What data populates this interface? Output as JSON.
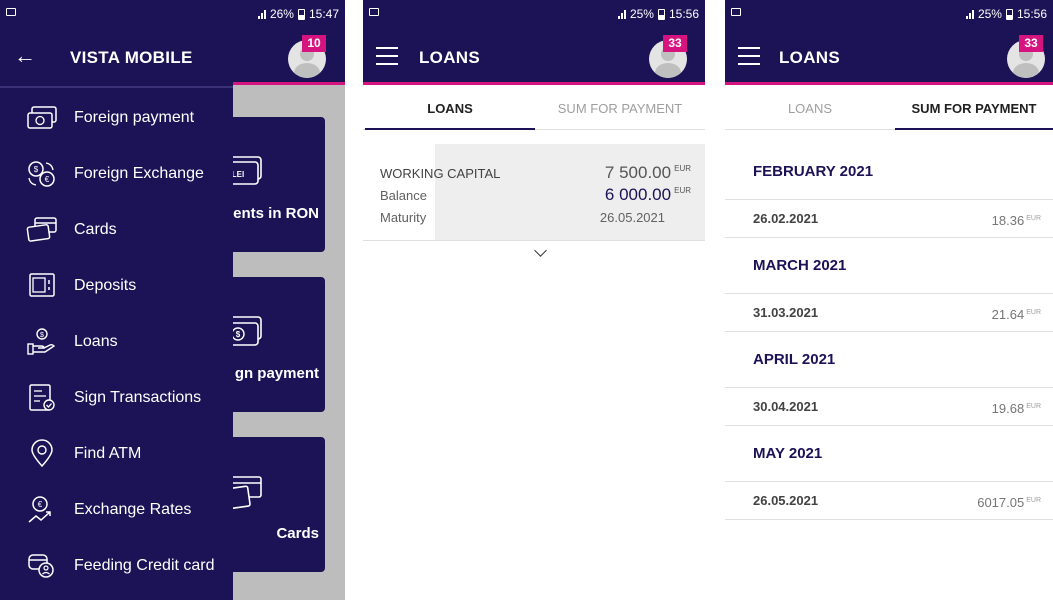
{
  "screen1": {
    "status": {
      "battery": "26%",
      "time": "15:47"
    },
    "drawer": {
      "title": "VISTA MOBILE",
      "items": [
        {
          "label": "Foreign payment",
          "icon": "foreign-payment-icon"
        },
        {
          "label": "Foreign Exchange",
          "icon": "exchange-icon"
        },
        {
          "label": "Cards",
          "icon": "cards-icon"
        },
        {
          "label": "Deposits",
          "icon": "deposits-icon"
        },
        {
          "label": "Loans",
          "icon": "loans-icon"
        },
        {
          "label": "Sign Transactions",
          "icon": "sign-icon"
        },
        {
          "label": "Find ATM",
          "icon": "location-pin-icon"
        },
        {
          "label": "Exchange Rates",
          "icon": "exchange-rates-icon"
        },
        {
          "label": "Feeding Credit card",
          "icon": "feeding-card-icon"
        }
      ]
    },
    "badge": "10",
    "tiles": [
      {
        "label": "ents in RON",
        "icon_text": "LEI"
      },
      {
        "label": "gn payment",
        "icon_text": "$"
      },
      {
        "label": "Cards",
        "icon_text": ""
      }
    ]
  },
  "screen2": {
    "status": {
      "battery": "25%",
      "time": "15:56"
    },
    "title": "LOANS",
    "badge": "33",
    "tabs": [
      {
        "label": "LOANS",
        "active": true
      },
      {
        "label": "SUM FOR PAYMENT",
        "active": false
      }
    ],
    "loan": {
      "name": "WORKING CAPITAL",
      "amount": "7 500.00",
      "balance_label": "Balance",
      "balance": "6 000.00",
      "maturity_label": "Maturity",
      "maturity": "26.05.2021",
      "currency": "EUR"
    }
  },
  "screen3": {
    "status": {
      "battery": "25%",
      "time": "15:56"
    },
    "title": "LOANS",
    "badge": "33",
    "tabs": [
      {
        "label": "LOANS",
        "active": false
      },
      {
        "label": "SUM FOR PAYMENT",
        "active": true
      }
    ],
    "schedule": [
      {
        "month": "FEBRUARY 2021",
        "date": "26.02.2021",
        "amount": "18.36",
        "currency": "EUR"
      },
      {
        "month": "MARCH 2021",
        "date": "31.03.2021",
        "amount": "21.64",
        "currency": "EUR"
      },
      {
        "month": "APRIL 2021",
        "date": "30.04.2021",
        "amount": "19.68",
        "currency": "EUR"
      },
      {
        "month": "MAY 2021",
        "date": "26.05.2021",
        "amount": "6017.05",
        "currency": "EUR"
      }
    ]
  },
  "colors": {
    "brand": "#1c1256",
    "accent": "#d6147f"
  }
}
